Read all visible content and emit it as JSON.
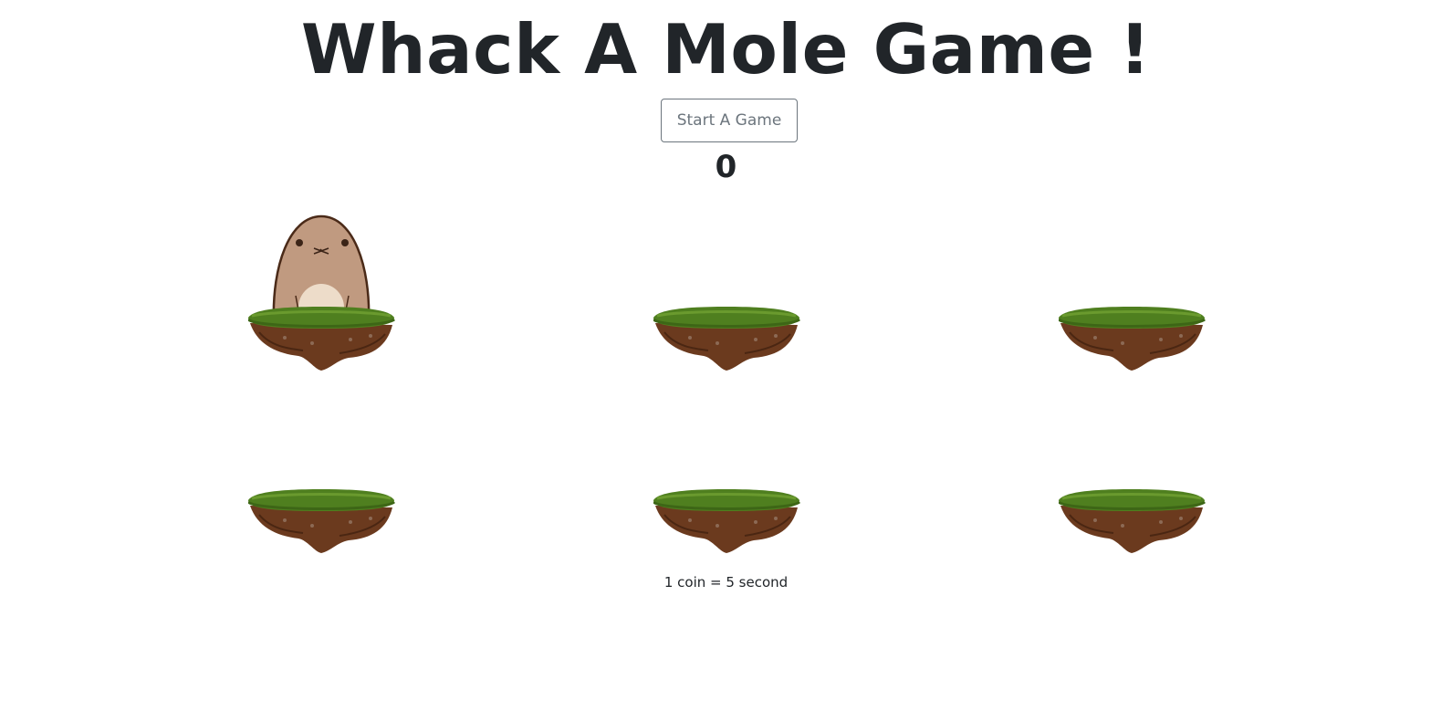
{
  "title": "Whack A Mole Game !",
  "start_button": {
    "label": "Start A Game"
  },
  "score": "0",
  "holes": [
    {
      "id": 1,
      "mole_visible": true
    },
    {
      "id": 2,
      "mole_visible": false
    },
    {
      "id": 3,
      "mole_visible": false
    },
    {
      "id": 4,
      "mole_visible": false
    },
    {
      "id": 5,
      "mole_visible": false
    },
    {
      "id": 6,
      "mole_visible": false
    }
  ],
  "note": "1 coin = 5 second",
  "colors": {
    "grass": "#4f7f1f",
    "dirt": "#6b3a1e",
    "mole": "#c09a80",
    "mole_belly": "#eddcc9",
    "text": "#212529",
    "button_border": "#6c757d"
  },
  "icons": {
    "hole": "grass-island",
    "mole": "mole"
  }
}
